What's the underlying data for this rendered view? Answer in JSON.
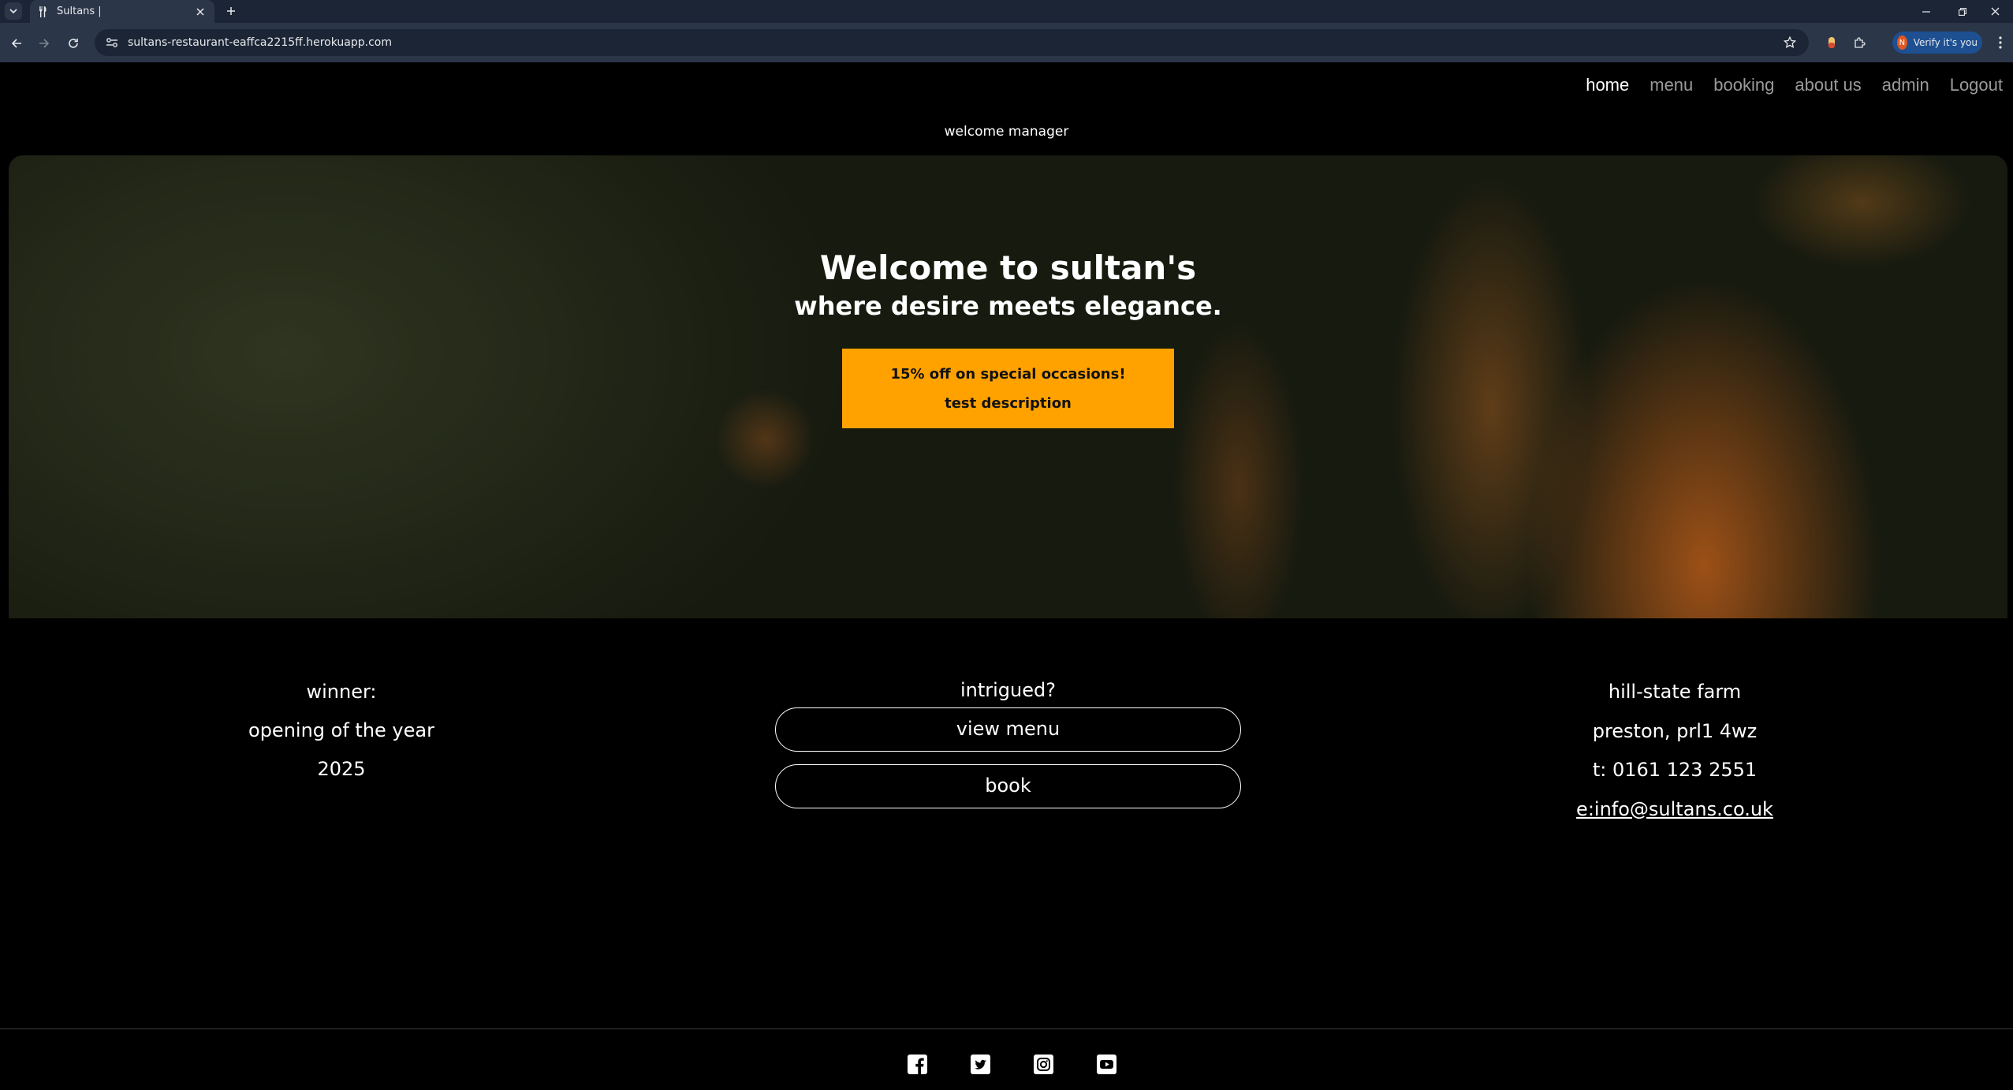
{
  "browser": {
    "tab_title": "Sultans |",
    "url": "sultans-restaurant-eaffca2215ff.herokuapp.com",
    "profile_initial": "N",
    "verify_label": "Verify it's you"
  },
  "nav": {
    "items": [
      {
        "label": "home",
        "active": true
      },
      {
        "label": "menu",
        "active": false
      },
      {
        "label": "booking",
        "active": false
      },
      {
        "label": "about us",
        "active": false
      },
      {
        "label": "admin",
        "active": false
      },
      {
        "label": "Logout",
        "active": false
      }
    ]
  },
  "welcome_user": "welcome manager",
  "hero": {
    "title": "Welcome to sultan's",
    "subtitle": "where desire meets elegance.",
    "offer": {
      "headline": "15% off on special occasions!",
      "description": "test description"
    }
  },
  "award": {
    "line1": "winner:",
    "line2": "opening of the year",
    "line3": "2025"
  },
  "cta": {
    "heading": "intrigued?",
    "view_menu": "view menu",
    "book": "book"
  },
  "contact": {
    "address1": "hill-state farm",
    "address2": "preston, prl1 4wz",
    "phone": "t: 0161 123 2551",
    "email": "e:info@sultans.co.uk"
  },
  "socials": [
    "facebook-icon",
    "twitter-icon",
    "instagram-icon",
    "youtube-icon"
  ],
  "colors": {
    "accent": "#ffa200",
    "background": "#000000",
    "nav_inactive": "#9a9a9a"
  }
}
